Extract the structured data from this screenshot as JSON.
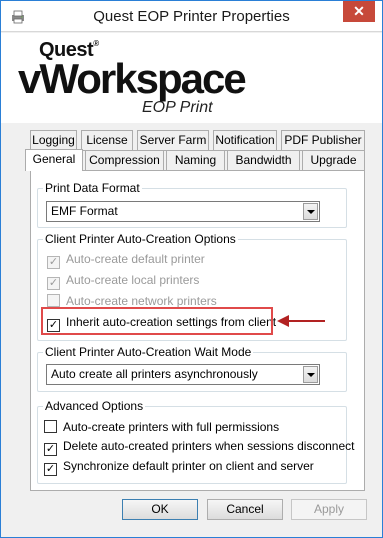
{
  "window": {
    "title": "Quest EOP Printer Properties",
    "close_glyph": "✕",
    "app_icon": "printer-icon"
  },
  "logo": {
    "brand": "Quest",
    "registered": "®",
    "product": "vWorkspace",
    "subtitle": "EOP Print"
  },
  "tabs": {
    "row1": [
      "Logging",
      "License",
      "Server Farm",
      "Notification",
      "PDF Publisher"
    ],
    "row2": [
      "General",
      "Compression",
      "Naming",
      "Bandwidth",
      "Upgrade"
    ],
    "active": "General"
  },
  "print_data_format": {
    "label": "Print Data Format",
    "value": "EMF Format"
  },
  "auto_creation": {
    "label": "Client Printer Auto-Creation Options",
    "options": [
      {
        "label": "Auto-create default printer",
        "checked": true,
        "disabled": true
      },
      {
        "label": "Auto-create local printers",
        "checked": true,
        "disabled": true
      },
      {
        "label": "Auto-create network printers",
        "checked": false,
        "disabled": true
      },
      {
        "label": "Inherit auto-creation settings from client",
        "checked": true,
        "disabled": false
      }
    ]
  },
  "wait_mode": {
    "label": "Client Printer Auto-Creation Wait Mode",
    "value": "Auto create all printers asynchronously"
  },
  "advanced": {
    "label": "Advanced Options",
    "options": [
      {
        "label": "Auto-create printers with full permissions",
        "checked": false
      },
      {
        "label": "Delete auto-created printers when sessions disconnect",
        "checked": true
      },
      {
        "label": "Synchronize default printer on client and server",
        "checked": true
      }
    ]
  },
  "buttons": {
    "ok": "OK",
    "cancel": "Cancel",
    "apply": "Apply"
  },
  "colors": {
    "highlight": "#e04a4a",
    "arrow": "#b22222",
    "window_border": "#2a7fd6"
  }
}
